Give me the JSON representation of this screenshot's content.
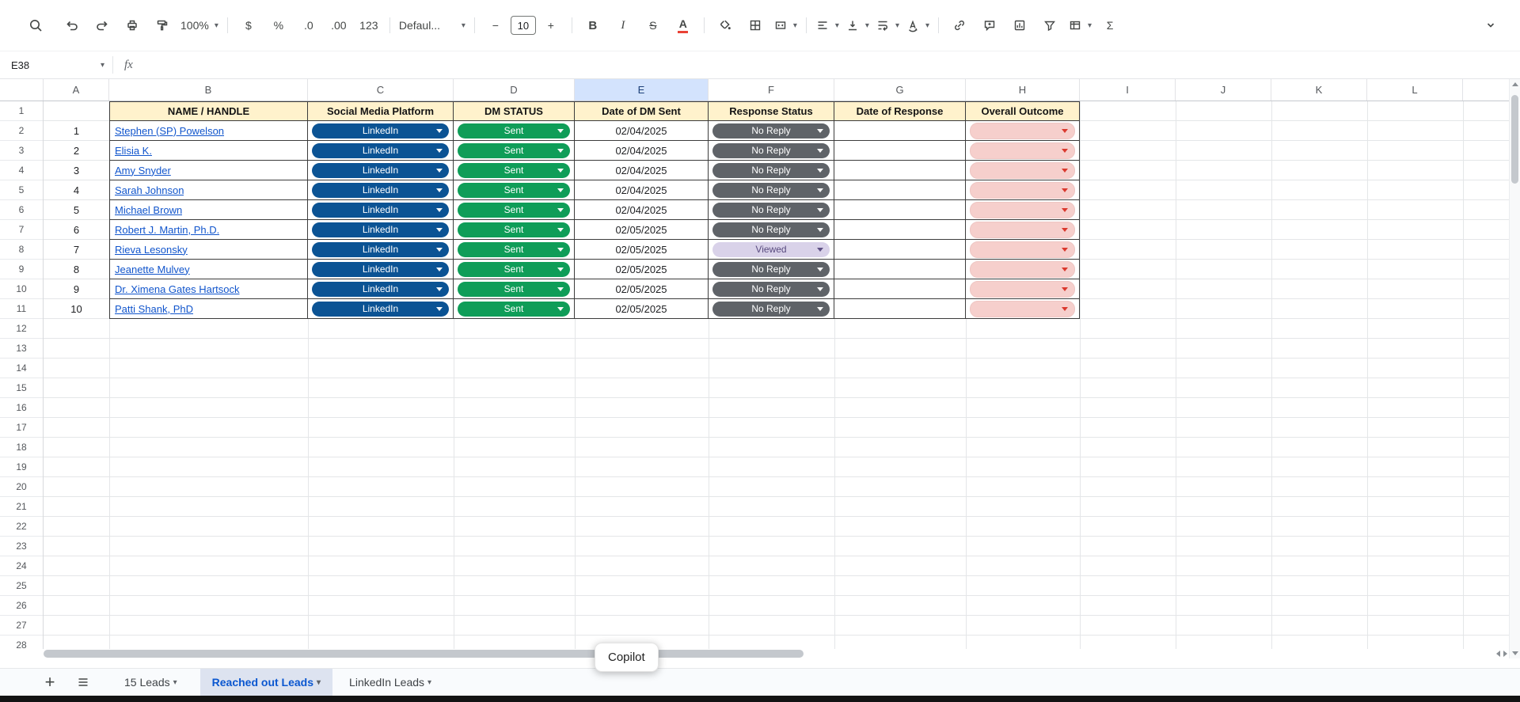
{
  "toolbar": {
    "zoom_value": "100%",
    "currency_label": "$",
    "percent_label": "%",
    "decrease_decimal_label": ".0",
    "increase_decimal_label": ".00",
    "number_format_label": "123",
    "font_name": "Defaul...",
    "minus_label": "−",
    "font_size": "10",
    "plus_label": "+",
    "bold_label": "B",
    "italic_label": "I",
    "strikethrough_label": "S",
    "text_color_label": "A",
    "functions_label": "Σ"
  },
  "formula_bar": {
    "cell_reference": "E38",
    "fx_label": "fx"
  },
  "grid": {
    "column_letters": [
      "A",
      "B",
      "C",
      "D",
      "E",
      "F",
      "G",
      "H",
      "I",
      "J",
      "K",
      "L"
    ],
    "selected_column": "E",
    "selected_cell": "E38",
    "row_count": 28
  },
  "table": {
    "headers": {
      "name": "NAME / HANDLE",
      "platform": "Social Media Platform",
      "dm_status": "DM STATUS",
      "date_sent": "Date of DM Sent",
      "response_status": "Response Status",
      "date_response": "Date of Response",
      "outcome": "Overall Outcome"
    },
    "rows": [
      {
        "num": "1",
        "name": "Stephen (SP) Powelson",
        "platform": "LinkedIn",
        "dm_status": "Sent",
        "date_sent": "02/04/2025",
        "response": "No Reply",
        "response_variant": "no-reply"
      },
      {
        "num": "2",
        "name": "Elisia K.",
        "platform": "LinkedIn",
        "dm_status": "Sent",
        "date_sent": "02/04/2025",
        "response": "No Reply",
        "response_variant": "no-reply"
      },
      {
        "num": "3",
        "name": "Amy Snyder",
        "platform": "LinkedIn",
        "dm_status": "Sent",
        "date_sent": "02/04/2025",
        "response": "No Reply",
        "response_variant": "no-reply"
      },
      {
        "num": "4",
        "name": "Sarah Johnson",
        "platform": "LinkedIn",
        "dm_status": "Sent",
        "date_sent": "02/04/2025",
        "response": "No Reply",
        "response_variant": "no-reply"
      },
      {
        "num": "5",
        "name": "Michael Brown",
        "platform": "LinkedIn",
        "dm_status": "Sent",
        "date_sent": "02/04/2025",
        "response": "No Reply",
        "response_variant": "no-reply"
      },
      {
        "num": "6",
        "name": "Robert J. Martin, Ph.D.",
        "platform": "LinkedIn",
        "dm_status": "Sent",
        "date_sent": "02/05/2025",
        "response": "No Reply",
        "response_variant": "no-reply"
      },
      {
        "num": "7",
        "name": "Rieva Lesonsky",
        "platform": "LinkedIn",
        "dm_status": "Sent",
        "date_sent": "02/05/2025",
        "response": "Viewed",
        "response_variant": "viewed"
      },
      {
        "num": "8",
        "name": "Jeanette Mulvey",
        "platform": "LinkedIn",
        "dm_status": "Sent",
        "date_sent": "02/05/2025",
        "response": "No Reply",
        "response_variant": "no-reply"
      },
      {
        "num": "9",
        "name": "Dr. Ximena Gates Hartsock",
        "platform": "LinkedIn",
        "dm_status": "Sent",
        "date_sent": "02/05/2025",
        "response": "No Reply",
        "response_variant": "no-reply"
      },
      {
        "num": "10",
        "name": "Patti Shank, PhD",
        "platform": "LinkedIn",
        "dm_status": "Sent",
        "date_sent": "02/05/2025",
        "response": "No Reply",
        "response_variant": "no-reply"
      }
    ]
  },
  "sheet_tabs": {
    "tabs": [
      {
        "label": "15 Leads",
        "active": false
      },
      {
        "label": "Reached out Leads",
        "active": true
      },
      {
        "label": "LinkedIn Leads",
        "active": false
      }
    ]
  },
  "tooltip": {
    "label": "Copilot"
  },
  "colors": {
    "linkedin_chip": "#0b5394",
    "sent_chip": "#0f9d58",
    "no_reply_chip": "#5f6368",
    "viewed_chip_bg": "#d9d2e9",
    "viewed_chip_text": "#584a7f",
    "outcome_chip_bg": "#f6cfcc",
    "outcome_caret": "#d93025",
    "header_row_bg": "#fff2cc",
    "selected_col_bg": "#d3e3fd",
    "active_tab_bg": "#dde3f0",
    "active_tab_text": "#0b57d0",
    "link_text": "#1155cc",
    "table_border": "#3c3c3c"
  }
}
